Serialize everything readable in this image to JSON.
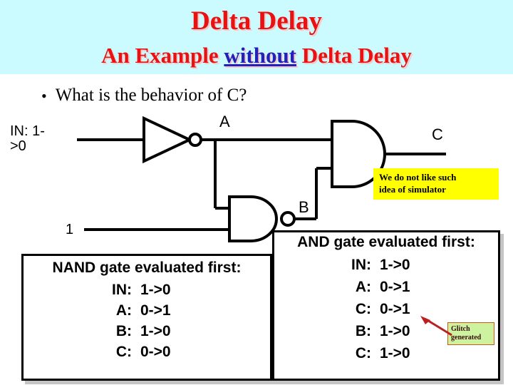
{
  "slide": {
    "title": "Delta Delay",
    "subtitle_part1": "An Example ",
    "subtitle_accent": "without",
    "subtitle_part2": " Delta Delay",
    "bullet": "What is the behavior of C?",
    "bullet_marker": "•"
  },
  "circuit": {
    "input_label": "IN: 1-\n>0",
    "constant_label": "1",
    "node_a": "A",
    "node_b": "B",
    "node_c": "C",
    "gates": [
      {
        "name": "inverter",
        "type": "NOT",
        "output": "A"
      },
      {
        "name": "nand-gate",
        "type": "NAND",
        "output": "B"
      },
      {
        "name": "and-gate",
        "type": "AND",
        "output": "C"
      }
    ]
  },
  "note_yellow": {
    "line1": "We do not like such",
    "line2": "idea of simulator",
    "background": "#ffff00"
  },
  "glitch_note": {
    "line1": "Glitch",
    "line2": "generated",
    "background": "#cdf2a0",
    "border": "#c05a1a",
    "arrow_color": "#bb2020"
  },
  "result_boxes": [
    {
      "id": "nand-first",
      "heading": "NAND gate evaluated first:",
      "rows": [
        {
          "signal": "IN:",
          "value": "1->0"
        },
        {
          "signal": "A:",
          "value": "0->1"
        },
        {
          "signal": "B:",
          "value": "1->0"
        },
        {
          "signal": "C:",
          "value": "0->0"
        }
      ]
    },
    {
      "id": "and-first",
      "heading": "AND gate evaluated first:",
      "rows": [
        {
          "signal": "IN:",
          "value": "1->0"
        },
        {
          "signal": "A:",
          "value": "0->1"
        },
        {
          "signal": "C:",
          "value": "0->1"
        },
        {
          "signal": "B:",
          "value": "1->0"
        },
        {
          "signal": "C:",
          "value": "1->0"
        }
      ]
    }
  ],
  "colors": {
    "header_band": "#ccfbff",
    "title_red": "#e81212",
    "accent_blue": "#2222bb",
    "wire_black": "#000000"
  }
}
